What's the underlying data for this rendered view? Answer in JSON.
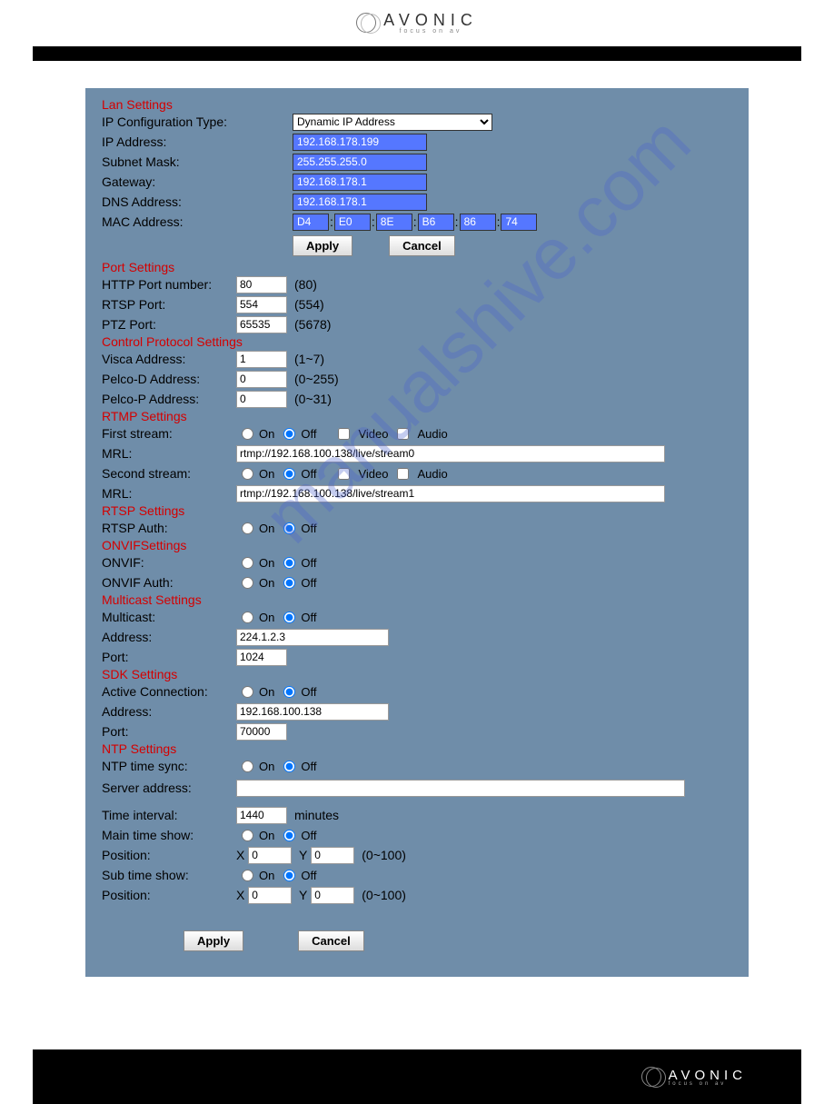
{
  "brand": {
    "name": "AVONIC",
    "subtitle": "focus on av"
  },
  "watermark": "manualshive.com",
  "sections": {
    "lan": {
      "title": "Lan Settings",
      "configType": "IP Configuration Type:",
      "configValue": "Dynamic IP Address",
      "ipLabel": "IP Address:",
      "ip": "192.168.178.199",
      "maskLabel": "Subnet Mask:",
      "mask": "255.255.255.0",
      "gwLabel": "Gateway:",
      "gw": "192.168.178.1",
      "dnsLabel": "DNS Address:",
      "dns": "192.168.178.1",
      "macLabel": "MAC Address:",
      "mac": [
        "D4",
        "E0",
        "8E",
        "B6",
        "86",
        "74"
      ]
    },
    "port": {
      "title": "Port Settings",
      "httpLabel": "HTTP Port number:",
      "http": "80",
      "httpHint": "(80)",
      "rtspLabel": "RTSP Port:",
      "rtsp": "554",
      "rtspHint": "(554)",
      "ptzLabel": "PTZ Port:",
      "ptz": "65535",
      "ptzHint": "(5678)"
    },
    "control": {
      "title": "Control Protocol Settings",
      "viscaLabel": "Visca Address:",
      "visca": "1",
      "viscaHint": "(1~7)",
      "pdLabel": "Pelco-D Address:",
      "pd": "0",
      "pdHint": "(0~255)",
      "ppLabel": "Pelco-P Address:",
      "pp": "0",
      "ppHint": "(0~31)"
    },
    "rtmp": {
      "title": "RTMP Settings",
      "firstLabel": "First stream:",
      "mrlLabel": "MRL:",
      "mrl1": "rtmp://192.168.100.138/live/stream0",
      "secondLabel": "Second stream:",
      "mrl2": "rtmp://192.168.100.138/live/stream1",
      "video": "Video",
      "audio": "Audio"
    },
    "rtsp": {
      "title": "RTSP Settings",
      "authLabel": "RTSP Auth:"
    },
    "onvif": {
      "title": "ONVIFSettings",
      "onvifLabel": "ONVIF:",
      "authLabel": "ONVIF Auth:"
    },
    "multicast": {
      "title": "Multicast Settings",
      "multicastLabel": "Multicast:",
      "addrLabel": "Address:",
      "addr": "224.1.2.3",
      "portLabel": "Port:",
      "port": "1024"
    },
    "sdk": {
      "title": "SDK Settings",
      "activeLabel": "Active Connection:",
      "addrLabel": "Address:",
      "addr": "192.168.100.138",
      "portLabel": "Port:",
      "port": "70000"
    },
    "ntp": {
      "title": "NTP Settings",
      "syncLabel": "NTP time sync:",
      "serverLabel": "Server address:",
      "server": "",
      "intervalLabel": "Time interval:",
      "interval": "1440",
      "intervalUnit": "minutes",
      "mainTimeLabel": "Main time show:",
      "positionLabel": "Position:",
      "x": "X",
      "y": "Y",
      "posHint": "(0~100)",
      "mainX": "0",
      "mainY": "0",
      "subTimeLabel": "Sub time show:",
      "subX": "0",
      "subY": "0"
    }
  },
  "ui": {
    "on": "On",
    "off": "Off",
    "apply": "Apply",
    "cancel": "Cancel"
  }
}
